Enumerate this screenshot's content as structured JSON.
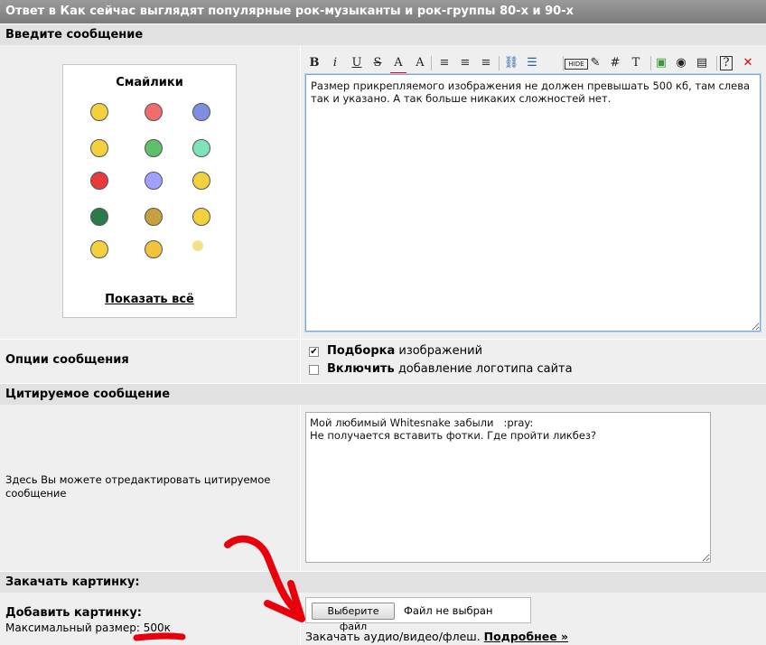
{
  "title": "Ответ в Как сейчас выглядят популярные рок-музыканты и рок-группы 80-х и 90-х",
  "compose": {
    "header": "Введите сообщение",
    "smilies_title": "Смайлики",
    "show_all": "Показать всё",
    "smilies": [
      "smiley-cool-icon",
      "smiley-love-icon",
      "smiley-sad-icon",
      "smiley-thinking-icon",
      "smiley-gun-icon",
      "smiley-sick-icon",
      "smiley-shooting-icon",
      "smiley-wave-icon",
      "smiley-cheer-icon",
      "smiley-ninja-icon",
      "smiley-pray-icon",
      "smiley-party-icon",
      "smiley-yes-icon",
      "smiley-laugh-icon",
      "smiley-sparkle-icon"
    ],
    "toolbar": [
      {
        "name": "bold-icon",
        "glyph": "B"
      },
      {
        "name": "italic-icon",
        "glyph": "i"
      },
      {
        "name": "underline-icon",
        "glyph": "U"
      },
      {
        "name": "strike-icon",
        "glyph": "S"
      },
      {
        "name": "font-color-icon",
        "glyph": "A"
      },
      {
        "name": "font-size-icon",
        "glyph": "A"
      },
      {
        "name": "align-left-icon",
        "glyph": "≡"
      },
      {
        "name": "align-center-icon",
        "glyph": "≡"
      },
      {
        "name": "align-right-icon",
        "glyph": "≡"
      },
      {
        "name": "link-icon",
        "glyph": "⛓"
      },
      {
        "name": "list-icon",
        "glyph": "☰"
      },
      {
        "name": "hide-icon",
        "glyph": "HIDE"
      },
      {
        "name": "edit-icon",
        "glyph": "✎"
      },
      {
        "name": "hash-icon",
        "glyph": "#"
      },
      {
        "name": "text-icon",
        "glyph": "T"
      },
      {
        "name": "image-icon",
        "glyph": "▣"
      },
      {
        "name": "flash-icon",
        "glyph": "◉"
      },
      {
        "name": "video-icon",
        "glyph": "▤"
      },
      {
        "name": "help-icon",
        "glyph": "?"
      },
      {
        "name": "close-icon",
        "glyph": "✕"
      }
    ],
    "message": "Размер прикрепляемого изображения не должен превышать 500 кб, там слева так и указано. А так больше никаких сложностей нет."
  },
  "options": {
    "label": "Опции сообщения",
    "opt1_bold": "Подборка",
    "opt1_rest": " изображений",
    "opt1_checked": true,
    "opt2_bold": "Включить",
    "opt2_rest": " добавление логотипа сайта",
    "opt2_checked": false
  },
  "quote": {
    "header": "Цитируемое сообщение",
    "label": "Здесь Вы можете отредактировать цитируемое сообщение",
    "text": "Мой любимый Whitesnake забыли   :pray:\nНе получается вставить фотки. Где пройти ликбез?"
  },
  "upload": {
    "header": "Закачать картинку:",
    "add_label": "Добавить картинку:",
    "max_label": "Максимальный размер: ",
    "max_value": "500к",
    "file_button": "Выберите файл",
    "file_status": "Файл не выбран",
    "media_text": "Закачать аудио/видео/флеш. ",
    "more_link": "Подробнее »"
  },
  "colors": {
    "annotation": "#e8000b",
    "title_bg": "#8a8a8a",
    "section_bg": "#e1e1e1",
    "row_bg": "#efefef"
  }
}
